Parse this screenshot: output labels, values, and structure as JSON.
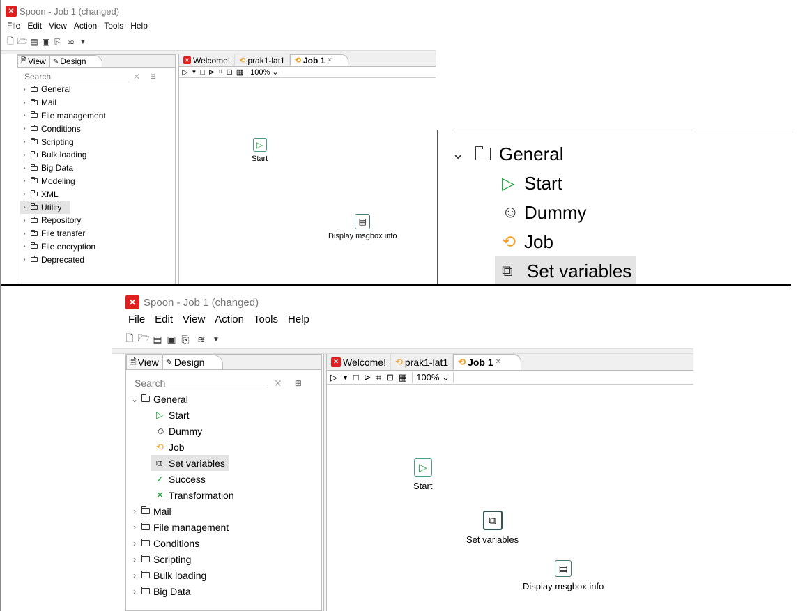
{
  "window": {
    "title": "Spoon - Job 1 (changed)"
  },
  "menu": [
    "File",
    "Edit",
    "View",
    "Action",
    "Tools",
    "Help"
  ],
  "toolbar_icons": [
    "new-file-icon",
    "open-file-icon",
    "explore-icon",
    "save-icon",
    "save-as-icon",
    "layers-icon",
    "dropdown-icon"
  ],
  "left_tabs": {
    "view": "View",
    "design": "Design"
  },
  "search": {
    "placeholder": "Search"
  },
  "job_tabs": {
    "welcome": "Welcome!",
    "prak": "prak1-lat1",
    "job": "Job 1"
  },
  "zoom": "100%",
  "tree_top": [
    "General",
    "Mail",
    "File management",
    "Conditions",
    "Scripting",
    "Bulk loading",
    "Big Data",
    "Modeling",
    "XML",
    "Utility",
    "Repository",
    "File transfer",
    "File encryption",
    "Deprecated"
  ],
  "general_children": [
    "Start",
    "Dummy",
    "Job",
    "Set variables",
    "Success",
    "Transformation"
  ],
  "tree_bottom_after": [
    "Mail",
    "File management",
    "Conditions",
    "Scripting",
    "Bulk loading",
    "Big Data"
  ],
  "canvas": {
    "start": "Start",
    "msgbox": "Display msgbox info",
    "setvars": "Set variables"
  },
  "zoomed": {
    "general": "General",
    "start": "Start",
    "dummy": "Dummy",
    "job": "Job",
    "setvars": "Set variables"
  }
}
